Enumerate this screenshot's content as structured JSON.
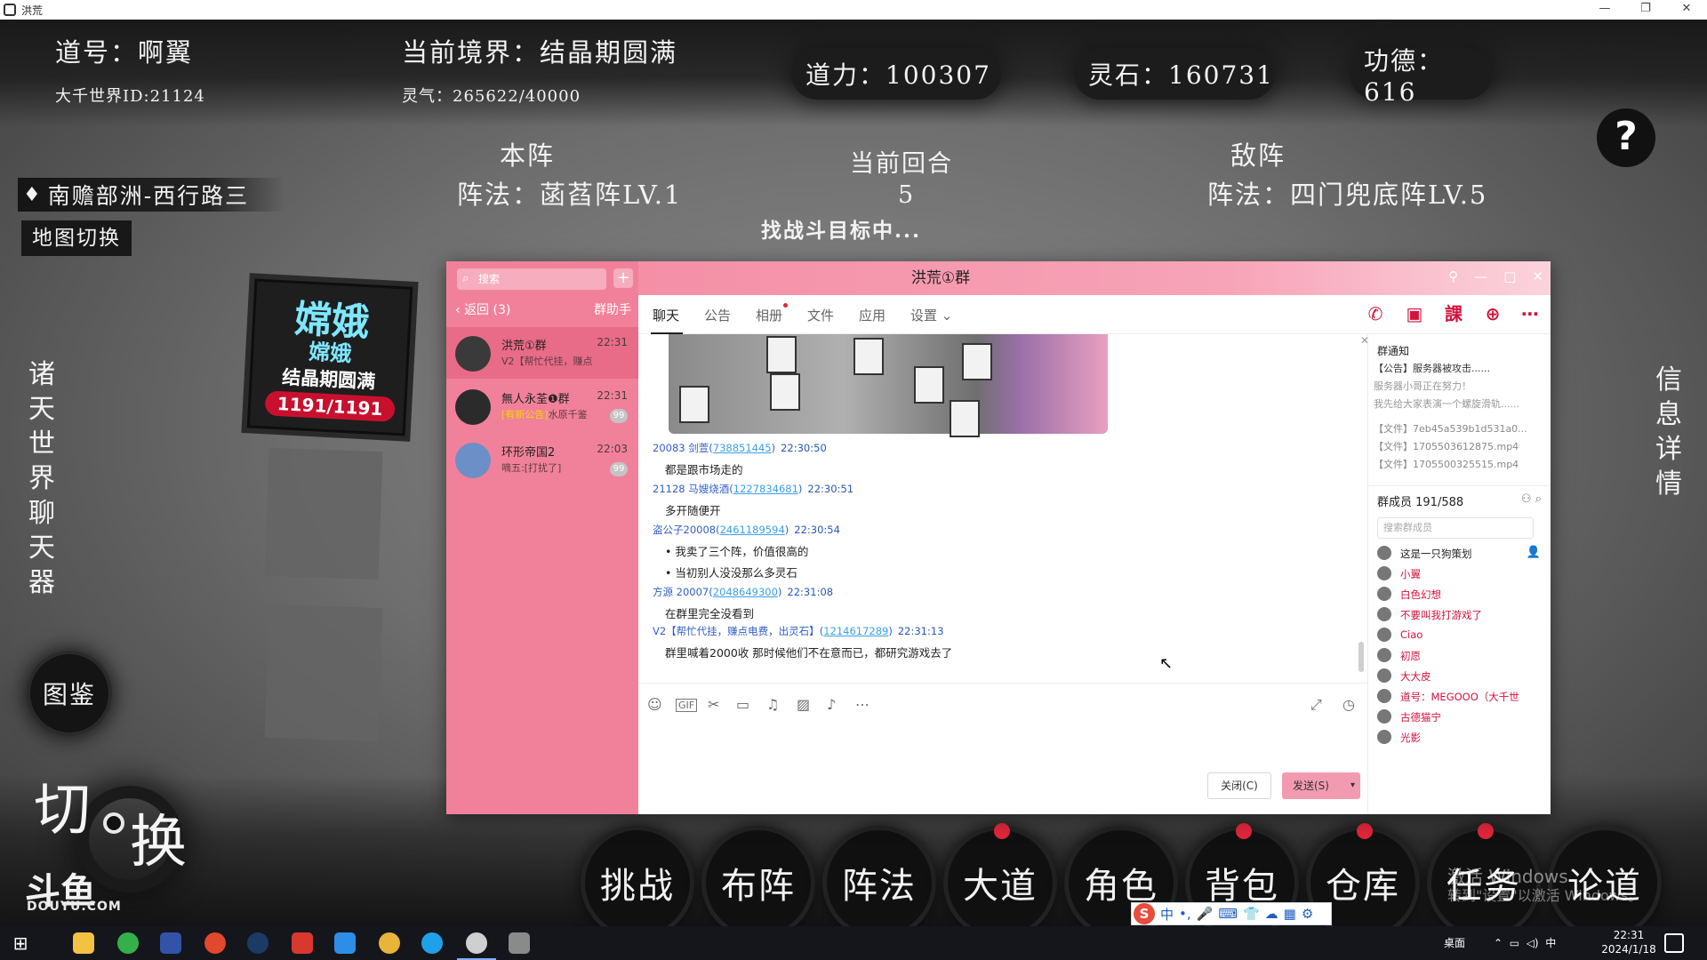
{
  "window": {
    "title": "洪荒"
  },
  "game": {
    "dao_name": "道号：啊翼",
    "world_id": "大千世界ID:21124",
    "realm": "当前境界：结晶期圆满",
    "lingqi": "灵气：265622/40000",
    "daoli": "道力：100307",
    "lingshi": "灵石：160731",
    "gongde": "功德：616",
    "help": "?",
    "location": "南赡部洲-西行路三",
    "map_switch": "地图切换",
    "ally_title": "本阵",
    "ally_formation": "阵法：菡萏阵LV.1",
    "enemy_title": "敌阵",
    "enemy_formation": "阵法：四门兜底阵LV.5",
    "round_title": "当前回合",
    "round_value": "5",
    "searching": "找战斗目标中...",
    "left_vertical": "诸天世界聊天器",
    "right_vertical": "信息详情",
    "codex": "图鉴",
    "switch_left": "切",
    "switch_right": "换",
    "douyu": "DOUYU.COM",
    "douyu_logo": "斗鱼",
    "character": {
      "name": "嫦娥",
      "name2": "嫦娥",
      "realm": "结晶期圆满",
      "hp": "1191/1191"
    },
    "bottom_buttons": [
      "挑战",
      "布阵",
      "阵法",
      "大道",
      "角色",
      "背包",
      "仓库",
      "任务",
      "论道"
    ],
    "watermark1": "激活 Windows",
    "watermark2": "转到\"设置\"以激活 Windows。"
  },
  "ime": {
    "items": [
      "中",
      "•,",
      "🎤",
      "⌨",
      "👕",
      "☁",
      "▦",
      "⚙"
    ]
  },
  "qq": {
    "search_placeholder": "搜索",
    "back": "返回 (3)",
    "helper": "群助手",
    "title": "洪荒①群",
    "conversations": [
      {
        "name": "洪荒①群",
        "time": "22:31",
        "msg": "V2【帮忙代挂，赚点",
        "badge": ""
      },
      {
        "name": "無人永荃❶群",
        "time": "22:31",
        "msg_hl": "[有新公告]",
        "msg": "水原千鉴",
        "badge": "99"
      },
      {
        "name": "环形帝国2",
        "time": "22:03",
        "msg": "嘀五:[打扰了]",
        "badge": "99"
      }
    ],
    "tabs": [
      "聊天",
      "公告",
      "相册",
      "文件",
      "应用",
      "设置"
    ],
    "messages": [
      {
        "user": "20083 剑萱",
        "qq": "738851445",
        "time": "22:30:50",
        "lines": [
          "都是跟市场走的"
        ]
      },
      {
        "user": "21128 马嫂烧酒",
        "qq": "1227834681",
        "time": "22:30:51",
        "lines": [
          "多开随便开"
        ]
      },
      {
        "user": "盗公子20008",
        "qq": "2461189594",
        "time": "22:30:54",
        "lines": [
          "我卖了三个阵，价值很高的",
          "当初别人没没那么多灵石"
        ]
      },
      {
        "user": "方源 20007",
        "qq": "2048649300",
        "time": "22:31:08",
        "lines": [
          "在群里完全没看到"
        ]
      },
      {
        "user": "V2【帮忙代挂，赚点电费，出灵石】",
        "qq": "1214617289",
        "time": "22:31:13",
        "lines": [
          "群里喊着2000收 那时候他们不在意而已，都研究游戏去了"
        ]
      }
    ],
    "compose": {
      "close": "关闭(C)",
      "send": "发送(S)"
    },
    "notice": {
      "title": "群通知",
      "announce": "【公告】服务器被攻击......",
      "lines": [
        "服务器小哥正在努力！",
        "我先给大家表演一个螺旋滑轨......"
      ],
      "files": [
        "【文件】7eb45a539b1d531a0...",
        "【文件】1705503612875.mp4",
        "【文件】1705500325515.mp4"
      ]
    },
    "members_title": "群成员 191/588",
    "member_search": "搜索群成员",
    "members": [
      {
        "name": "这是一只狗策划",
        "color": "#222222",
        "icon": "👤"
      },
      {
        "name": "小翼",
        "color": "#d3133d",
        "icon": "✎"
      },
      {
        "name": "白色幻想",
        "color": "#d3133d",
        "icon": ""
      },
      {
        "name": "不要叫我打游戏了",
        "color": "#d3133d",
        "icon": ""
      },
      {
        "name": "Ciao",
        "color": "#d3133d",
        "icon": ""
      },
      {
        "name": "初愿",
        "color": "#d3133d",
        "icon": ""
      },
      {
        "name": "大大皮",
        "color": "#d3133d",
        "icon": ""
      },
      {
        "name": "道号：MEGOOO（大千世",
        "color": "#d3133d",
        "icon": ""
      },
      {
        "name": "古德猫宁",
        "color": "#d3133d",
        "icon": ""
      },
      {
        "name": "光影",
        "color": "#d3133d",
        "icon": ""
      }
    ]
  },
  "taskbar": {
    "desktop": "桌面",
    "tray_lang": "中",
    "time": "22:31",
    "date": "2024/1/18"
  }
}
